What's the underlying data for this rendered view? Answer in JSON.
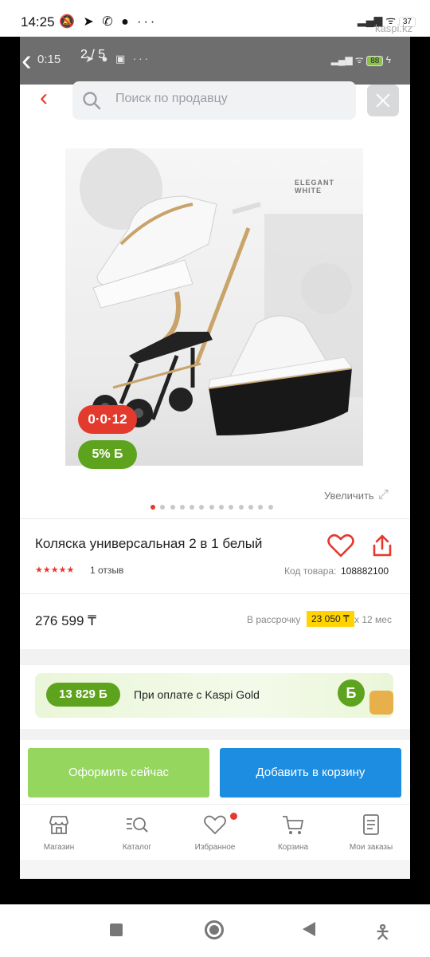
{
  "phone_status": {
    "time": "14:25",
    "battery": "37",
    "watermark": "kaspi.kz"
  },
  "inner_status": {
    "counter": "2 / 5",
    "time": "0:15",
    "battery": "88"
  },
  "search": {
    "placeholder": "Поиск по продавцу"
  },
  "photo": {
    "brand_text": "ELEGANT WHITE",
    "badge_age": "0·0·12",
    "badge_bonus": "5% Б"
  },
  "gallery": {
    "total": 13,
    "active": 0,
    "zoom_label": "Увеличить"
  },
  "product": {
    "title": "Коляска универсальная 2 в 1 белый",
    "stars": "★★★★★",
    "rating": 5,
    "reviews": "1 отзыв",
    "code_label": "Код товара:",
    "code_value": "108882100",
    "price": "276 599 ₸",
    "installment_label": "В рассрочку",
    "installment_amount": "23 050 ₸",
    "installment_term": "х 12 мес"
  },
  "kaspi_gold": {
    "amount": "13 829 Б",
    "text": "При оплате с Kaspi Gold",
    "coin": "Б"
  },
  "actions": {
    "order": "Оформить сейчас",
    "cart": "Добавить в корзину"
  },
  "tabs": [
    {
      "label": "Магазин",
      "icon": "shop-icon"
    },
    {
      "label": "Каталог",
      "icon": "catalog-search-icon"
    },
    {
      "label": "Избранное",
      "icon": "heart-icon"
    },
    {
      "label": "Корзина",
      "icon": "cart-icon"
    },
    {
      "label": "Мои заказы",
      "icon": "orders-icon"
    }
  ],
  "colors": {
    "accent_red": "#e4392e",
    "kaspi_green": "#5ea31d",
    "order_green": "#94d65e",
    "cart_blue": "#1c8de0",
    "installment_yellow": "#ffd400"
  }
}
